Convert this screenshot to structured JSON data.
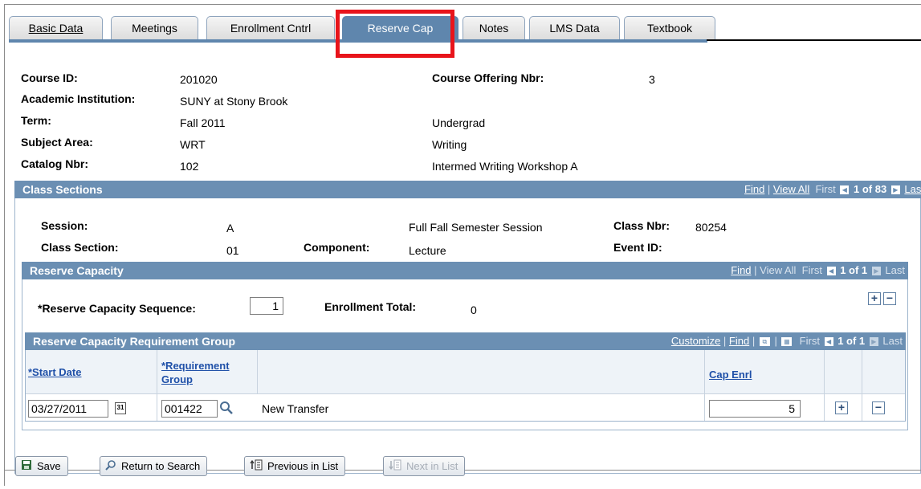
{
  "tabs": [
    {
      "label": "Basic Data",
      "active": false
    },
    {
      "label": "Meetings",
      "active": false
    },
    {
      "label": "Enrollment Cntrl",
      "active": false
    },
    {
      "label": "Reserve Cap",
      "active": true
    },
    {
      "label": "Notes",
      "active": false
    },
    {
      "label": "LMS Data",
      "active": false
    },
    {
      "label": "Textbook",
      "active": false
    }
  ],
  "course": {
    "course_id_label": "Course ID:",
    "course_id": "201020",
    "institution_label": "Academic Institution:",
    "institution": "SUNY at Stony Brook",
    "term_label": "Term:",
    "term": "Fall 2011",
    "subject_label": "Subject Area:",
    "subject": "WRT",
    "catalog_label": "Catalog Nbr:",
    "catalog": "102",
    "offering_label": "Course Offering Nbr:",
    "offering": "3",
    "career": "Undergrad",
    "subject_desc": "Writing",
    "catalog_desc": "Intermed Writing Workshop A"
  },
  "class_sections": {
    "title": "Class Sections",
    "find": "Find",
    "view_all": "View All",
    "first": "First",
    "count": "1 of 83",
    "last": "Last",
    "session_label": "Session:",
    "session": "A",
    "session_desc": "Full Fall Semester Session",
    "class_nbr_label": "Class Nbr:",
    "class_nbr": "80254",
    "section_label": "Class Section:",
    "section": "01",
    "component_label": "Component:",
    "component": "Lecture",
    "event_label": "Event ID:"
  },
  "reserve_capacity": {
    "title": "Reserve Capacity",
    "find": "Find",
    "view_all": "View All",
    "first": "First",
    "count": "1 of 1",
    "last": "Last",
    "sequence_label": "*Reserve Capacity Sequence:",
    "sequence": "1",
    "enroll_total_label": "Enrollment Total:",
    "enroll_total": "0"
  },
  "req_group": {
    "title": "Reserve Capacity Requirement Group",
    "customize": "Customize",
    "find": "Find",
    "first": "First",
    "count": "1 of 1",
    "last": "Last",
    "col_start": "*Start Date",
    "col_req_1": "*Requirement",
    "col_req_2": "Group",
    "col_cap": "Cap Enrl",
    "row": {
      "start_date": "03/27/2011",
      "group": "001422",
      "group_desc": "New Transfer",
      "cap": "5"
    }
  },
  "toolbar": {
    "save": "Save",
    "return": "Return to Search",
    "previous": "Previous in List",
    "next": "Next in List"
  },
  "colors": {
    "header_bar": "#6b8fb3",
    "active_tab": "#5f86ad",
    "highlight": "#e8141b",
    "link": "#1f50a8"
  }
}
